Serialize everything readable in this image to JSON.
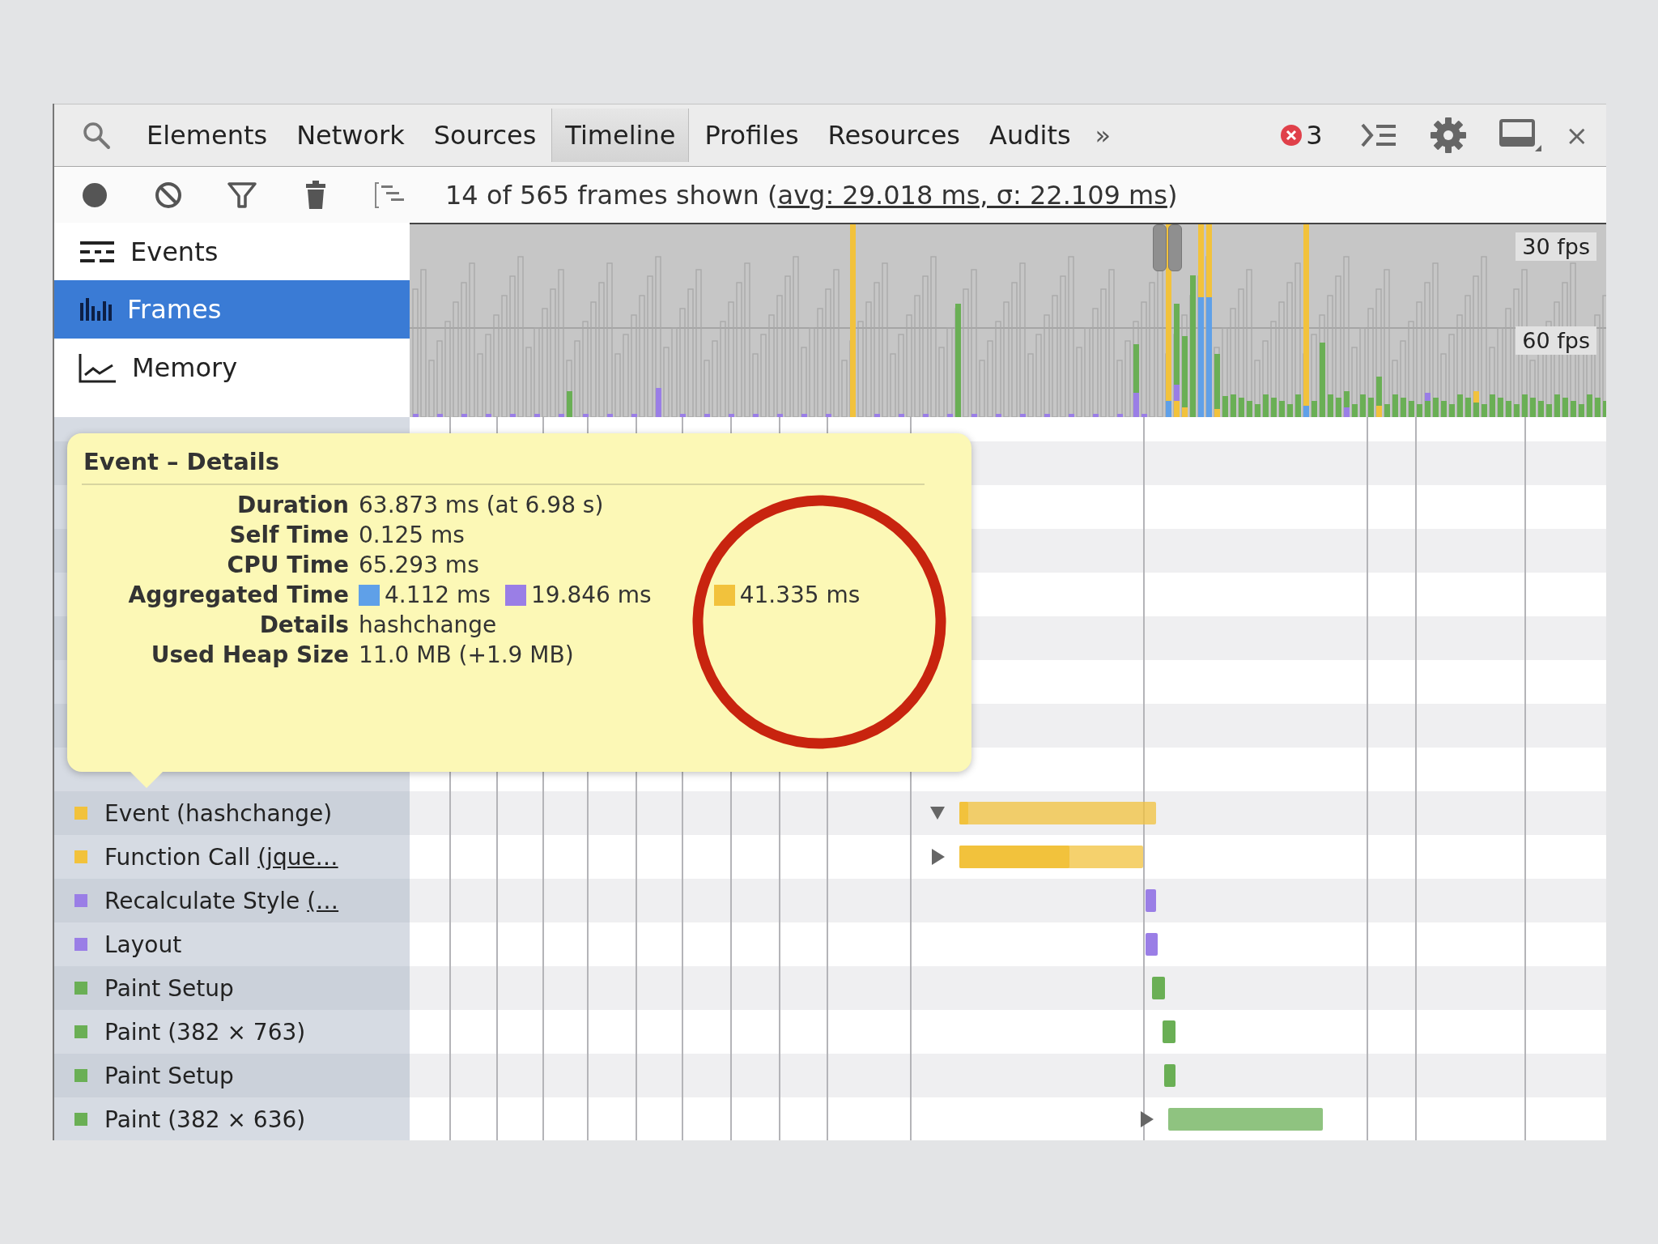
{
  "panel_tabs": [
    {
      "label": "Elements",
      "selected": false
    },
    {
      "label": "Network",
      "selected": false
    },
    {
      "label": "Sources",
      "selected": false
    },
    {
      "label": "Timeline",
      "selected": true
    },
    {
      "label": "Profiles",
      "selected": false
    },
    {
      "label": "Resources",
      "selected": false
    },
    {
      "label": "Audits",
      "selected": false
    }
  ],
  "overflow_button": "»",
  "error_count": "3",
  "close_button": "×",
  "toolbar": {
    "summary": "14 of 565 frames shown (",
    "stats_link": "avg: 29.018 ms, σ: 22.109 ms",
    "summary_end": ")"
  },
  "views": [
    {
      "label": "Events",
      "kind": "events",
      "selected": false
    },
    {
      "label": "Frames",
      "kind": "frames",
      "selected": true
    },
    {
      "label": "Memory",
      "kind": "memory",
      "selected": false
    }
  ],
  "overview": {
    "fps_labels": [
      "30 fps",
      "60 fps"
    ]
  },
  "records": [
    {
      "label": "Event (hashchange)",
      "color": "#f2c23c",
      "kind": "group",
      "expanded": true
    },
    {
      "label": "Function Call",
      "link": "(jque…",
      "color": "#f2c23c",
      "kind": "group",
      "expanded": false
    },
    {
      "label": "Recalculate Style",
      "link": "(…",
      "color": "#9a7ee6",
      "kind": "leaf"
    },
    {
      "label": "Layout",
      "color": "#9a7ee6",
      "kind": "leaf"
    },
    {
      "label": "Paint Setup",
      "color": "#6aaf55",
      "kind": "leaf"
    },
    {
      "label": "Paint (382 × 763)",
      "color": "#6aaf55",
      "kind": "leaf"
    },
    {
      "label": "Paint Setup",
      "color": "#6aaf55",
      "kind": "leaf"
    },
    {
      "label": "Paint (382 × 636)",
      "color": "#6aaf55",
      "kind": "group",
      "expanded": false
    }
  ],
  "tooltip": {
    "title": "Event – Details",
    "rows": [
      {
        "label": "Duration",
        "kind": "text",
        "value": "63.873 ms (at 6.98 s)"
      },
      {
        "label": "Self Time",
        "kind": "text",
        "value": "0.125 ms"
      },
      {
        "label": "CPU Time",
        "kind": "text",
        "value": "65.293 ms"
      },
      {
        "label": "Aggregated Time",
        "kind": "swatches",
        "items": [
          {
            "color": "#5fa0e8",
            "value": "4.112 ms"
          },
          {
            "color": "#9a7ee6",
            "value": "19.846 ms"
          },
          {
            "color": "#f2c23c",
            "value": "41.335 ms"
          }
        ]
      },
      {
        "label": "Details",
        "kind": "text",
        "value": "hashchange"
      },
      {
        "label": "Used Heap Size",
        "kind": "text",
        "value": "11.0 MB (+1.9 MB)"
      }
    ]
  }
}
